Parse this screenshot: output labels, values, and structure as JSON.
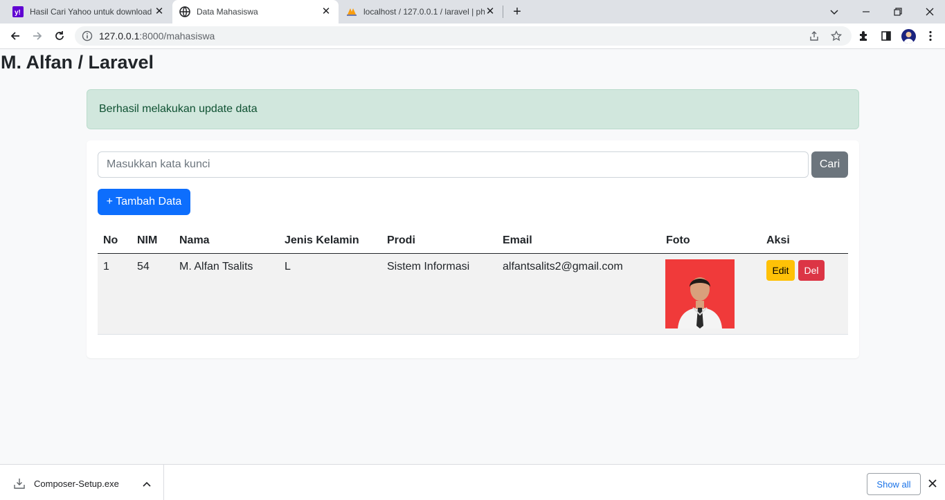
{
  "browser": {
    "tabs": [
      {
        "title": "Hasil Cari Yahoo untuk download",
        "favicon": "yahoo-icon",
        "active": false
      },
      {
        "title": "Data Mahasiswa",
        "favicon": "globe-icon",
        "active": true
      },
      {
        "title": "localhost / 127.0.0.1 / laravel | ph",
        "favicon": "phpmyadmin-icon",
        "active": false
      }
    ],
    "url_host": "127.0.0.1",
    "url_rest": ":8000/mahasiswa"
  },
  "page": {
    "brand": "M. Alfan / Laravel",
    "alert": "Berhasil melakukan update data",
    "search": {
      "placeholder": "Masukkan kata kunci",
      "value": "",
      "button": "Cari"
    },
    "add_button": "+ Tambah Data",
    "table": {
      "headers": [
        "No",
        "NIM",
        "Nama",
        "Jenis Kelamin",
        "Prodi",
        "Email",
        "Foto",
        "Aksi"
      ],
      "rows": [
        {
          "no": "1",
          "nim": "54",
          "nama": "M. Alfan Tsalits",
          "jk": "L",
          "prodi": "Sistem Informasi",
          "email": "alfantsalits2@gmail.com",
          "edit": "Edit",
          "del": "Del"
        }
      ]
    }
  },
  "downloads": {
    "file": "Composer-Setup.exe",
    "show_all": "Show all"
  },
  "colors": {
    "primary": "#0d6efd",
    "secondary": "#6c757d",
    "warning": "#ffc107",
    "danger": "#dc3545",
    "alert_bg": "#d1e7dd",
    "alert_text": "#0f5132",
    "photo_bg": "#f03a3a"
  }
}
